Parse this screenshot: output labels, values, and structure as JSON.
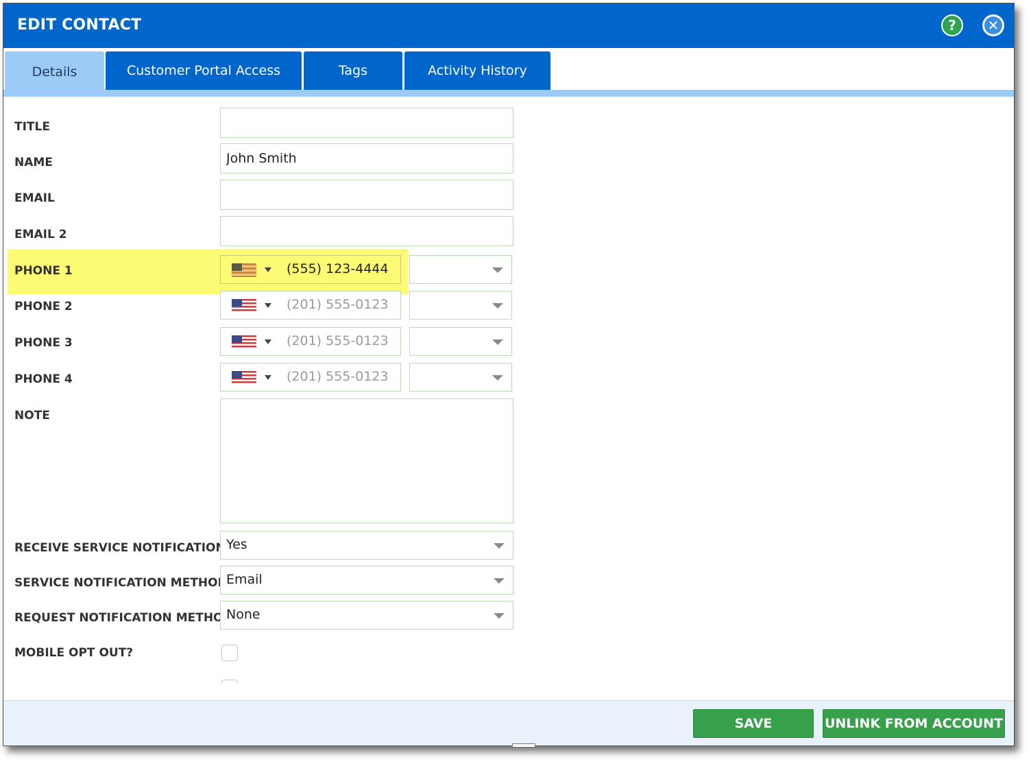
{
  "dialog": {
    "title": "EDIT CONTACT"
  },
  "tabs": [
    {
      "label": "Details",
      "active": true
    },
    {
      "label": "Customer Portal Access",
      "active": false
    },
    {
      "label": "Tags",
      "active": false
    },
    {
      "label": "Activity History",
      "active": false
    }
  ],
  "form": {
    "title": {
      "label": "TITLE",
      "value": ""
    },
    "name": {
      "label": "NAME",
      "value": "John Smith"
    },
    "email": {
      "label": "EMAIL",
      "value": ""
    },
    "email2": {
      "label": "EMAIL 2",
      "value": ""
    },
    "phones": [
      {
        "label": "PHONE 1",
        "value": "(555) 123-4444",
        "placeholder": false
      },
      {
        "label": "PHONE 2",
        "value": "(201) 555-0123",
        "placeholder": true
      },
      {
        "label": "PHONE 3",
        "value": "(201) 555-0123",
        "placeholder": true
      },
      {
        "label": "PHONE 4",
        "value": "(201) 555-0123",
        "placeholder": true
      }
    ],
    "note": {
      "label": "NOTE",
      "value": ""
    },
    "receive_notifications": {
      "label": "RECEIVE SERVICE NOTIFICATIONS",
      "value": "Yes"
    },
    "service_method": {
      "label": "SERVICE NOTIFICATION METHOD",
      "value": "Email"
    },
    "request_method": {
      "label": "REQUEST NOTIFICATION METHOD",
      "value": "None"
    },
    "mobile_opt_out": {
      "label": "MOBILE OPT OUT?",
      "checked": false
    }
  },
  "footer": {
    "save_label": "SAVE",
    "unlink_label": "UNLINK FROM ACCOUNT"
  },
  "help_glyph": "?",
  "close_glyph": "✕",
  "colors": {
    "header": "#0066cc",
    "tab_active": "#9ccbf7",
    "button": "#36a04a",
    "highlight": "#fdfb73"
  }
}
